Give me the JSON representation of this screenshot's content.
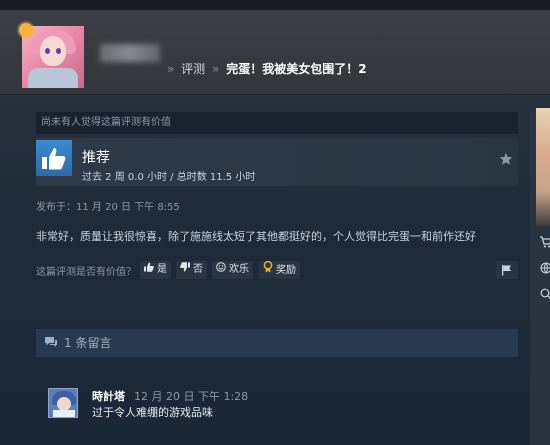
{
  "breadcrumb": {
    "separator": "»",
    "items": [
      "评测",
      "完蛋！我被美女包围了！2"
    ]
  },
  "review": {
    "helpful_count_text": "尚未有人觉得这篇评测有价值",
    "recommendation": "推荐",
    "hours": "过去 2 周 0.0 小时 / 总时数 11.5 小时",
    "posted": "发布于：11 月 20 日 下午 8:55",
    "body": "非常好，质量让我很惊喜，除了施施线太短了其他都挺好的，个人觉得比完蛋一和前作还好",
    "vote_question": "这篇评测是否有价值？",
    "vote_yes": "是",
    "vote_no": "否",
    "vote_funny": "欢乐",
    "award": "奖励"
  },
  "comments": {
    "header": "1 条留言",
    "items": [
      {
        "author": "時計塔",
        "time": "12 月 20 日 下午 1:28",
        "text": "过于令人难绷的游戏品味"
      }
    ]
  },
  "icons": {
    "thumb": "thumbs-up-icon",
    "star": "star-icon",
    "flag": "flag-icon",
    "comment": "comment-bubble-icon"
  },
  "colors": {
    "background": "#1b2838",
    "accent": "#3e8ad1",
    "award": "#e3b62b"
  }
}
